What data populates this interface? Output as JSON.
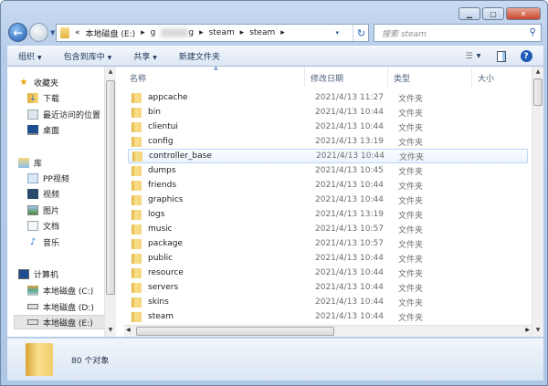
{
  "window": {
    "min_icon": "minimize-icon",
    "max_icon": "maximize-icon",
    "close_icon": "close-icon"
  },
  "address": {
    "overflow": "«",
    "segments": [
      "本地磁盘 (E:)",
      "g",
      "g",
      "steam",
      "steam"
    ],
    "sep": "▸",
    "dropdown": "▾",
    "refresh": "↻"
  },
  "search": {
    "placeholder": "搜索 steam"
  },
  "toolbar": {
    "organize": "组织",
    "include_library": "包含到库中",
    "share": "共享",
    "new_folder": "新建文件夹"
  },
  "sidebar": {
    "favorites": {
      "label": "收藏夹",
      "items": [
        "下载",
        "最近访问的位置",
        "桌面"
      ]
    },
    "libraries": {
      "label": "库",
      "items": [
        "PP视频",
        "视频",
        "图片",
        "文档",
        "音乐"
      ]
    },
    "computer": {
      "label": "计算机",
      "items": [
        "本地磁盘 (C:)",
        "本地磁盘 (D:)",
        "本地磁盘 (E:)"
      ]
    }
  },
  "columns": {
    "name": "名称",
    "modified": "修改日期",
    "type": "类型",
    "size": "大小"
  },
  "files": [
    {
      "name": "appcache",
      "modified": "2021/4/13 11:27",
      "type": "文件夹"
    },
    {
      "name": "bin",
      "modified": "2021/4/13 10:44",
      "type": "文件夹"
    },
    {
      "name": "clientui",
      "modified": "2021/4/13 10:44",
      "type": "文件夹"
    },
    {
      "name": "config",
      "modified": "2021/4/13 13:19",
      "type": "文件夹"
    },
    {
      "name": "controller_base",
      "modified": "2021/4/13 10:44",
      "type": "文件夹"
    },
    {
      "name": "dumps",
      "modified": "2021/4/13 10:45",
      "type": "文件夹"
    },
    {
      "name": "friends",
      "modified": "2021/4/13 10:44",
      "type": "文件夹"
    },
    {
      "name": "graphics",
      "modified": "2021/4/13 10:44",
      "type": "文件夹"
    },
    {
      "name": "logs",
      "modified": "2021/4/13 13:19",
      "type": "文件夹"
    },
    {
      "name": "music",
      "modified": "2021/4/13 10:57",
      "type": "文件夹"
    },
    {
      "name": "package",
      "modified": "2021/4/13 10:57",
      "type": "文件夹"
    },
    {
      "name": "public",
      "modified": "2021/4/13 10:44",
      "type": "文件夹"
    },
    {
      "name": "resource",
      "modified": "2021/4/13 10:44",
      "type": "文件夹"
    },
    {
      "name": "servers",
      "modified": "2021/4/13 10:44",
      "type": "文件夹"
    },
    {
      "name": "skins",
      "modified": "2021/4/13 10:44",
      "type": "文件夹"
    },
    {
      "name": "steam",
      "modified": "2021/4/13 10:44",
      "type": "文件夹"
    }
  ],
  "status": {
    "count": "80 个对象"
  }
}
